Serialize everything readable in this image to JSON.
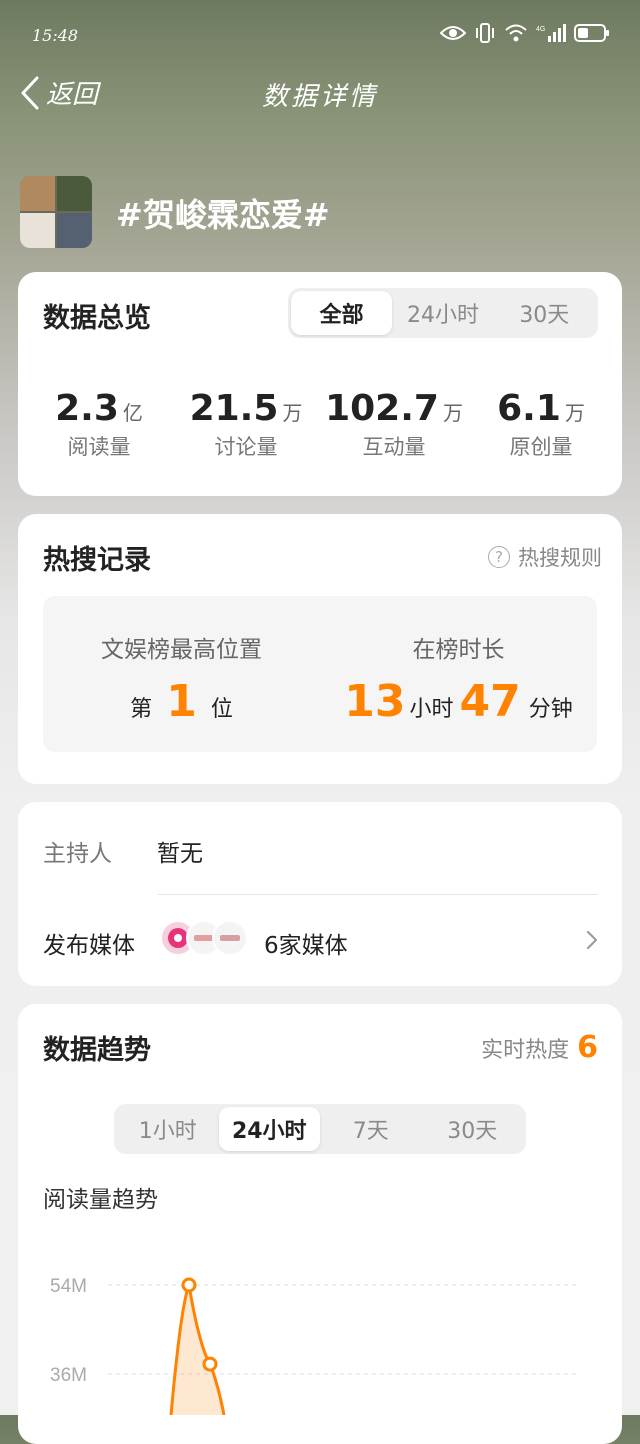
{
  "status_bar": {
    "time": "15:48"
  },
  "header": {
    "back_label": "返回",
    "title": "数据详情"
  },
  "topic": {
    "title": "#贺峻霖恋爱#"
  },
  "overview": {
    "title": "数据总览",
    "tabs": [
      {
        "label": "全部",
        "active": true
      },
      {
        "label": "24小时",
        "active": false
      },
      {
        "label": "30天",
        "active": false
      }
    ],
    "stats": [
      {
        "value": "2.3",
        "unit": "亿",
        "label": "阅读量"
      },
      {
        "value": "21.5",
        "unit": "万",
        "label": "讨论量"
      },
      {
        "value": "102.7",
        "unit": "万",
        "label": "互动量"
      },
      {
        "value": "6.1",
        "unit": "万",
        "label": "原创量"
      }
    ]
  },
  "hot_search": {
    "title": "热搜记录",
    "rules_link": "热搜规则",
    "highest": {
      "label": "文娱榜最高位置",
      "prefix": "第",
      "value": "1",
      "suffix": "位"
    },
    "duration": {
      "label": "在榜时长",
      "hours": "13",
      "hours_unit": "小时",
      "minutes": "47",
      "minutes_unit": "分钟"
    }
  },
  "info": {
    "host_label": "主持人",
    "host_value": "暂无",
    "media_label": "发布媒体",
    "media_value": "6家媒体"
  },
  "trend": {
    "title": "数据趋势",
    "realtime_label": "实时热度",
    "realtime_value": "6",
    "tabs": [
      {
        "label": "1小时",
        "active": false
      },
      {
        "label": "24小时",
        "active": true
      },
      {
        "label": "7天",
        "active": false
      },
      {
        "label": "30天",
        "active": false
      }
    ],
    "chart_title": "阅读量趋势"
  },
  "chart_data": {
    "type": "area",
    "title": "阅读量趋势",
    "y_ticks": [
      "54M",
      "36M"
    ],
    "y_tick_values": [
      54,
      36
    ],
    "points": [
      {
        "x": 1,
        "y": 54
      },
      {
        "x": 2,
        "y": 38
      }
    ],
    "color": "#ff8200"
  },
  "colors": {
    "accent": "#ff8200"
  }
}
